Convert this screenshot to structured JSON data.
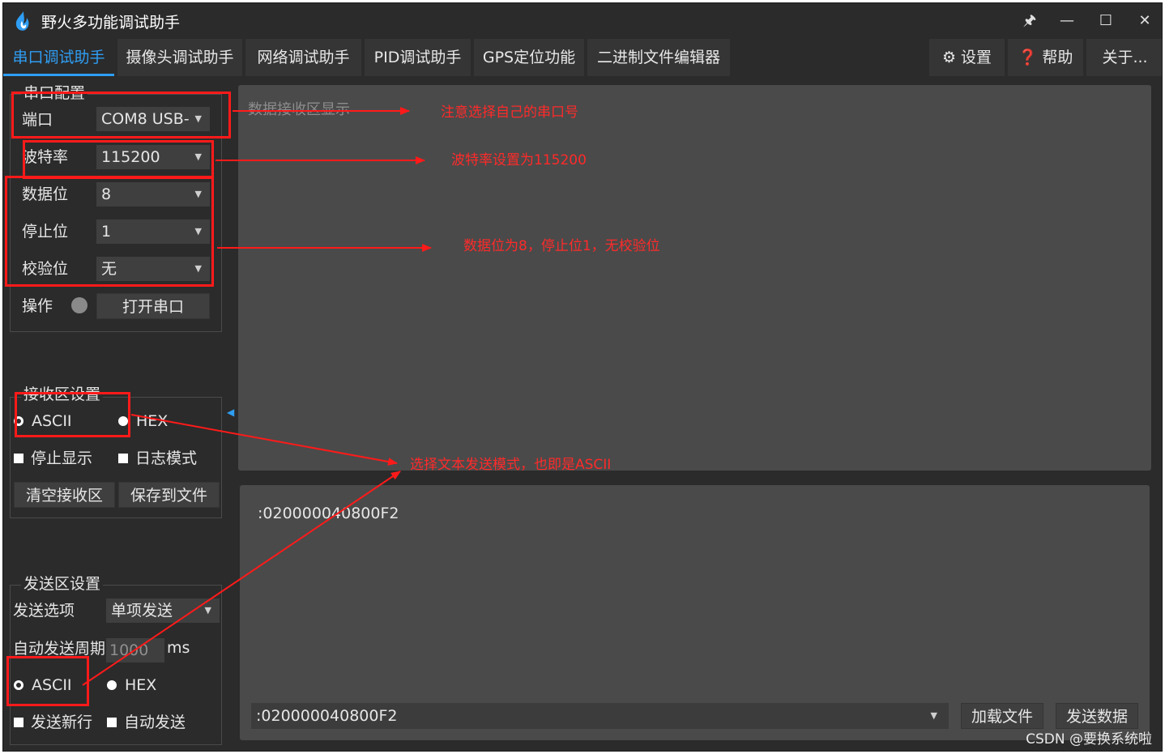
{
  "window": {
    "title": "野火多功能调试助手",
    "controls": {
      "pin": "🖈",
      "minimize": "—",
      "maximize": "☐",
      "close": "✕"
    }
  },
  "menu": {
    "tabs": [
      "串口调试助手",
      "摄像头调试助手",
      "网络调试助手",
      "PID调试助手",
      "GPS定位功能",
      "二进制文件编辑器"
    ],
    "active_tab": "串口调试助手",
    "settings": "设置",
    "help": "帮助",
    "about": "关于..."
  },
  "serial_config": {
    "title": "串口配置",
    "port_label": "端口",
    "port_value": "COM8 USB-",
    "baud_label": "波特率",
    "baud_value": "115200",
    "databits_label": "数据位",
    "databits_value": "8",
    "stopbits_label": "停止位",
    "stopbits_value": "1",
    "parity_label": "校验位",
    "parity_value": "无",
    "operation_label": "操作",
    "open_button": "打开串口"
  },
  "recv_settings": {
    "title": "接收区设置",
    "ascii": "ASCII",
    "hex": "HEX",
    "stop_display": "停止显示",
    "log_mode": "日志模式",
    "clear_button": "清空接收区",
    "save_button": "保存到文件"
  },
  "send_settings": {
    "title": "发送区设置",
    "option_label": "发送选项",
    "option_value": "单项发送",
    "period_label": "自动发送周期",
    "period_value": "1000",
    "period_unit": "ms",
    "ascii": "ASCII",
    "hex": "HEX",
    "newline": "发送新行",
    "auto_send": "自动发送"
  },
  "recv_area": {
    "placeholder": "数据接收区显示"
  },
  "send_area": {
    "text": ":020000040800F2",
    "combo_value": ":020000040800F2",
    "load_button": "加载文件",
    "send_button": "发送数据"
  },
  "annotations": {
    "port_note": "注意选择自己的串口号",
    "baud_note": "波特率设置为115200",
    "bits_note": "数据位为8，停止位1，无校验位",
    "mode_note": "选择文本发送模式，也即是ASCII"
  },
  "watermark": "CSDN @要换系统啦",
  "colors": {
    "accent": "#2f9ef4",
    "annotation": "#ff1a1a",
    "background": "#2b2b2b",
    "area": "#4a4a4a"
  }
}
